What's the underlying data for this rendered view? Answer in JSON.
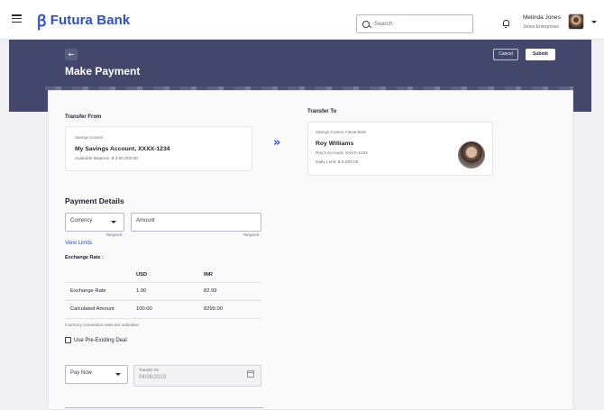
{
  "header": {
    "brand": "Futura Bank",
    "search_placeholder": "Search",
    "user_name": "Melinda Jones",
    "user_company": "Jones Enterprises"
  },
  "page": {
    "title": "Make Payment",
    "back_label": "←",
    "cancel_label": "Cancel",
    "submit_label": "Submit"
  },
  "transfer_from": {
    "label": "Transfer From",
    "account_type": "Savings Account",
    "account_name": "My Savings Account, XXXX-1234",
    "balance": "Available Balance: $ 3,00,000.00"
  },
  "transfer_to": {
    "label": "Transfer To",
    "account_type": "Savings Account, Futura Bank",
    "payee_name": "Roy Williams",
    "payee_account": "Roy's Account, XXXX-1234",
    "daily_limit": "Daily Limit: $ 5,000.00"
  },
  "payment_details": {
    "heading": "Payment Details",
    "currency_placeholder": "Currency",
    "currency_hint": "Required",
    "amount_placeholder": "Amount",
    "amount_hint": "Required",
    "view_limits": "View Limits",
    "exchange_rate_label": "Exchange Rate :",
    "table": {
      "headers": [
        "",
        "USD",
        "INR"
      ],
      "rows": [
        [
          "Exchange Rate",
          "1.00",
          "82.99"
        ],
        [
          "Calculated Amount",
          "100.00",
          "8299.00"
        ]
      ]
    },
    "rates_note": "Currency conversion rates are indicative",
    "pre_existing_deal": "Use Pre-Existing Deal",
    "pay_option": "Pay Now",
    "transfer_on_label": "Transfer On",
    "transfer_on_value": "04/06/2023"
  },
  "colors": {
    "brand": "#2c4fd1",
    "banner": "#43476b"
  }
}
